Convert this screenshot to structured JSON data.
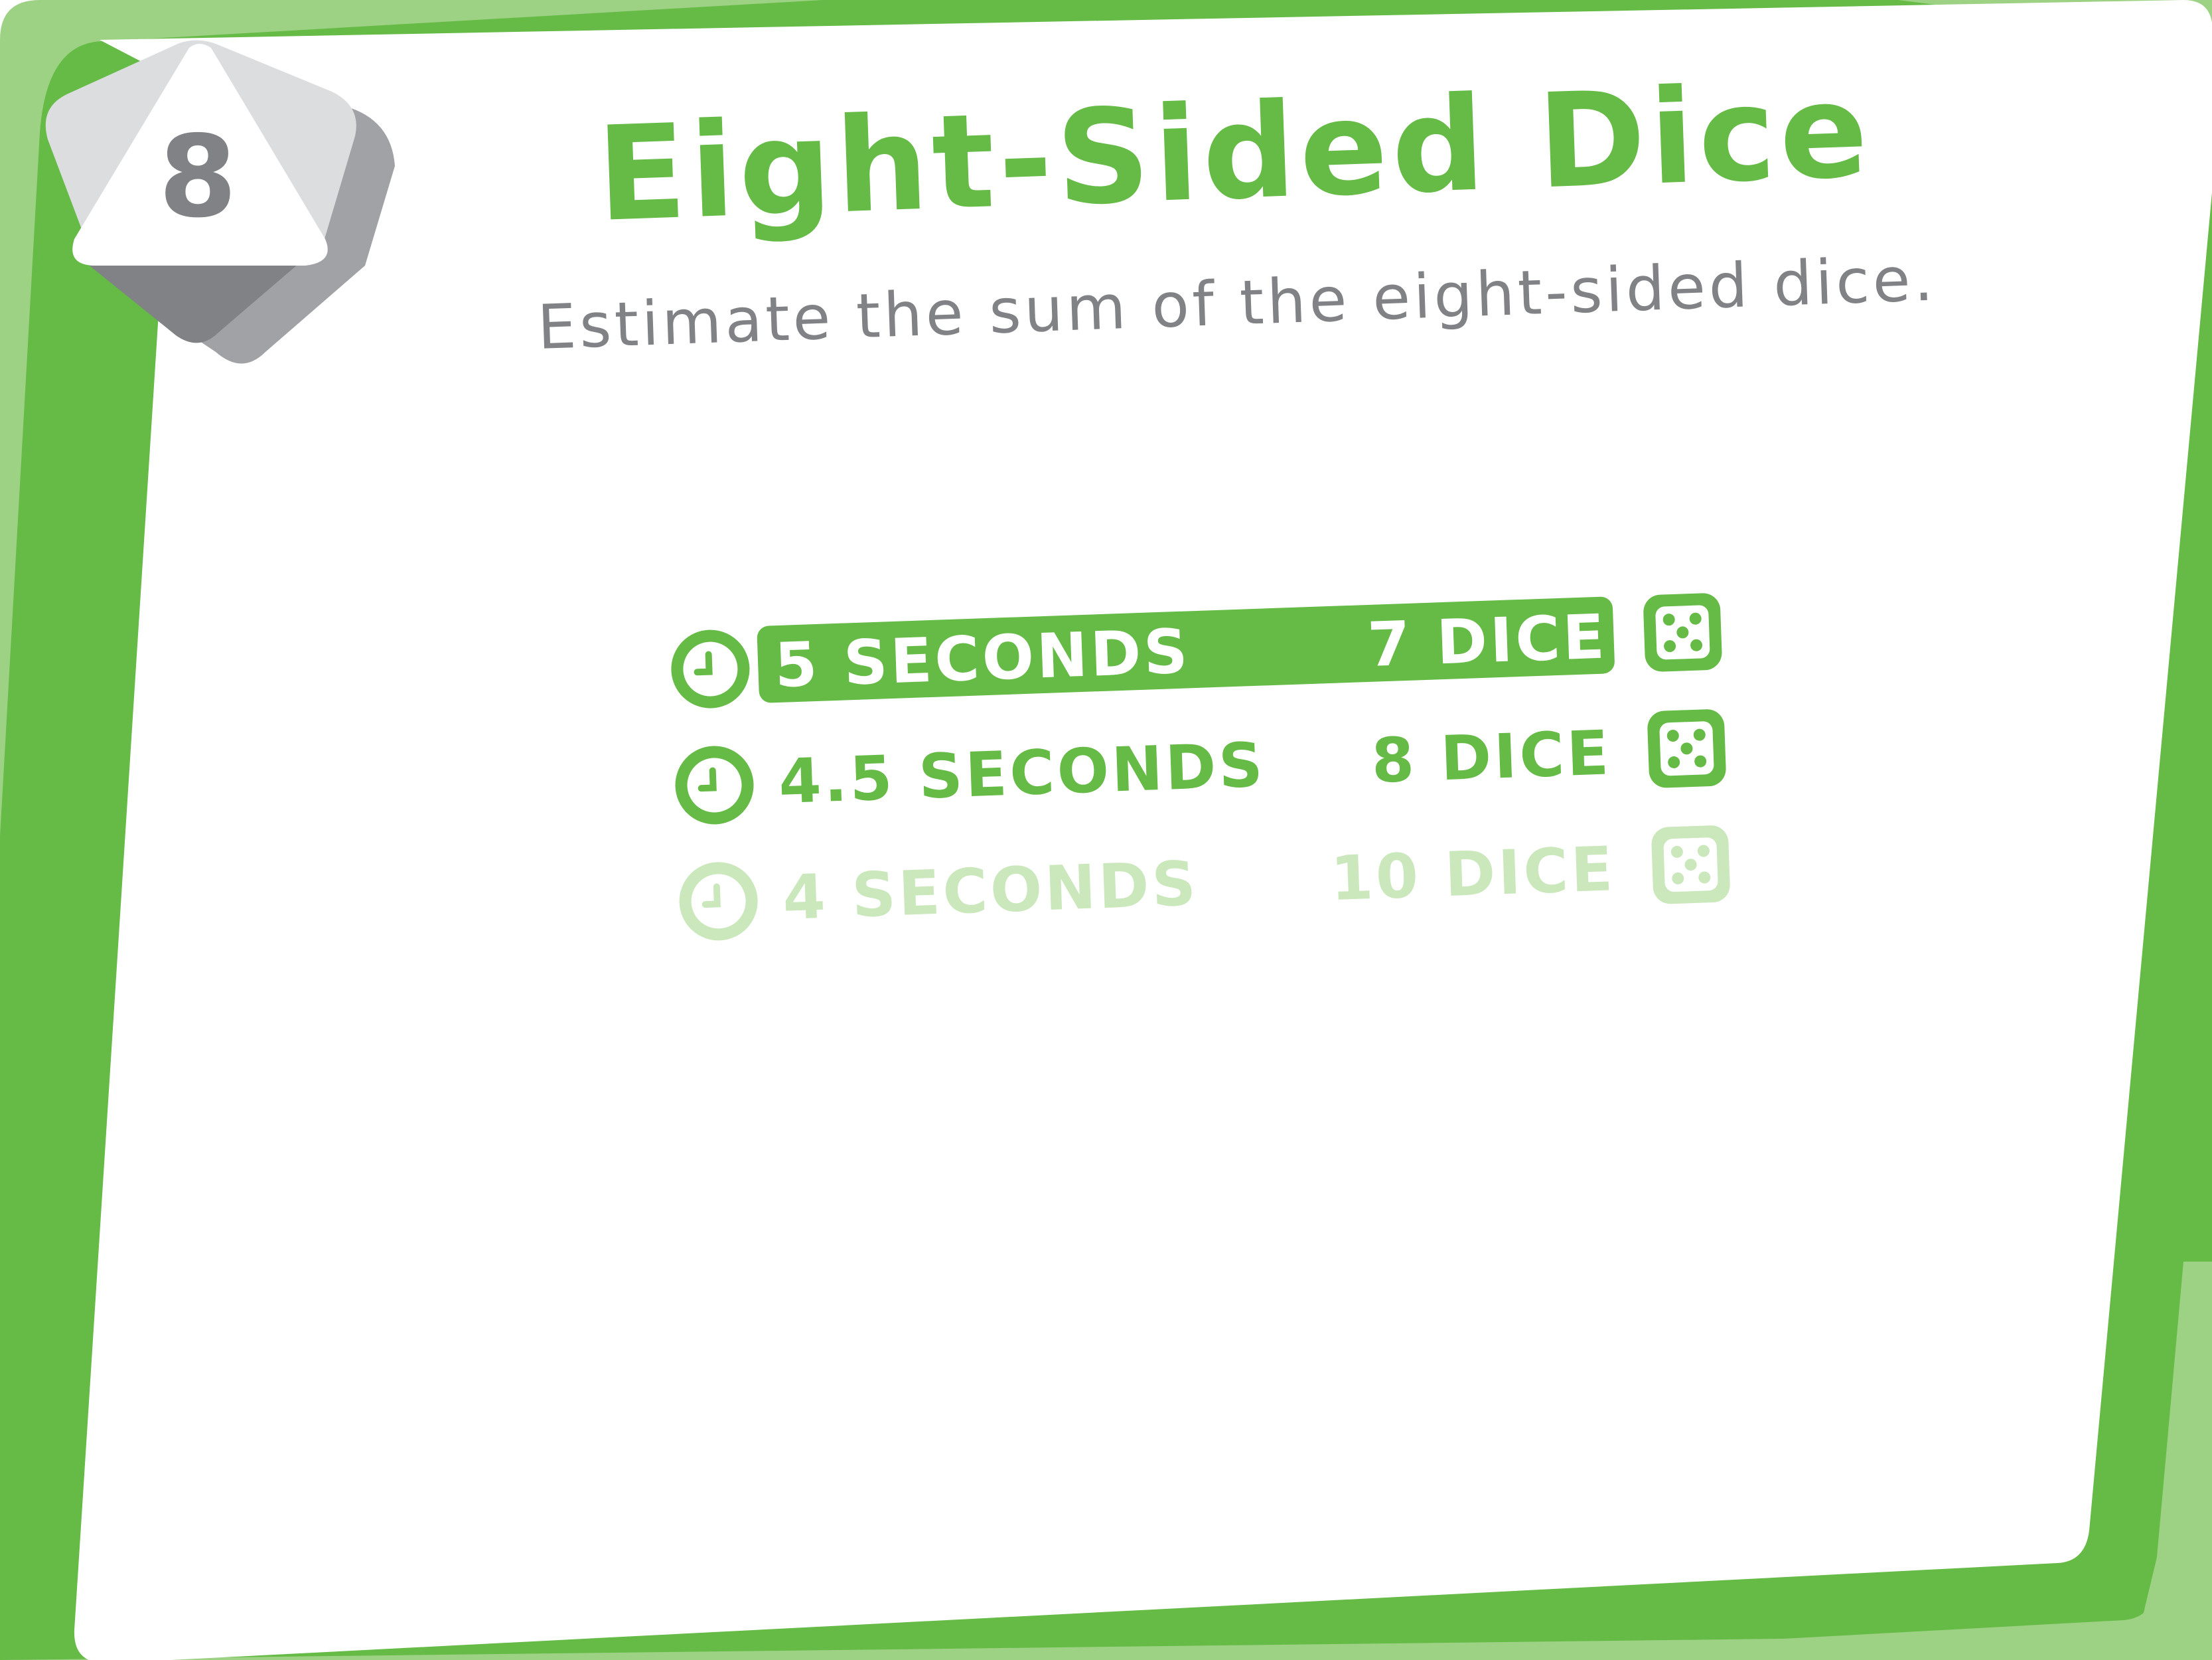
{
  "level_badge": {
    "number": "8"
  },
  "title": "Eight-Sided Dice",
  "subtitle": "Estimate the sum of the eight-sided dice.",
  "options": [
    {
      "time": "5 SECONDS",
      "dice": "7 DICE",
      "state": "selected"
    },
    {
      "time": "4.5 SECONDS",
      "dice": "8 DICE",
      "state": "normal"
    },
    {
      "time": "4 SECONDS",
      "dice": "10 DICE",
      "state": "locked"
    }
  ],
  "icons": {
    "badge": "d8-octahedron-die-icon",
    "timer": "clock-icon",
    "dice": "five-pip-die-icon"
  },
  "colors": {
    "accent_green": "#65bb46",
    "frame_light_green": "#9dd184",
    "faded_green": "#cbe8bd",
    "gray_text": "#808285",
    "badge_dark_gray": "#808285",
    "badge_mid_gray": "#a1a2a5",
    "badge_light_gray": "#dcdddf",
    "white": "#ffffff"
  }
}
